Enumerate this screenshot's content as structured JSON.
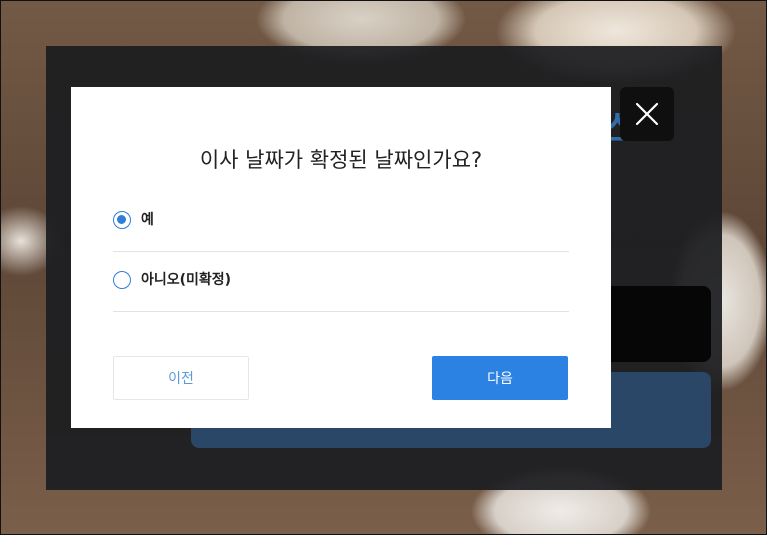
{
  "background": {
    "title_fragment": "스토"
  },
  "dialog": {
    "title": "이사 날짜가 확정된 날짜인가요?",
    "options": [
      {
        "label": "예",
        "selected": true
      },
      {
        "label": "아니오(미확정)",
        "selected": false
      }
    ],
    "buttons": {
      "prev": "이전",
      "next": "다음"
    }
  },
  "colors": {
    "accent": "#2b82e2",
    "radio": "#2f7fd8",
    "overlay": "#1c1d20",
    "behind_button": "#2b4767"
  },
  "icons": {
    "close": "close-icon"
  }
}
